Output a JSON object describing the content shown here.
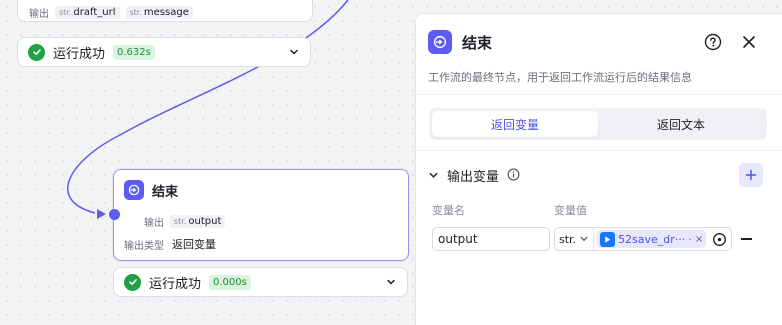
{
  "canvas": {
    "top_node": {
      "output_label": "输出",
      "outputs": [
        {
          "type": "str.",
          "name": "draft_url"
        },
        {
          "type": "str.",
          "name": "message"
        }
      ]
    },
    "status_top": {
      "label": "运行成功",
      "time": "0.632s"
    },
    "end_node": {
      "title": "结束",
      "output_label": "输出",
      "output_type": "str.",
      "output_name": "output",
      "output_kind_label": "输出类型",
      "output_kind_value": "返回变量"
    },
    "status_bottom": {
      "label": "运行成功",
      "time": "0.000s"
    }
  },
  "panel": {
    "title": "结束",
    "description": "工作流的最终节点，用于返回工作流运行后的结果信息",
    "tabs": [
      {
        "label": "返回变量",
        "active": true
      },
      {
        "label": "返回文本",
        "active": false
      }
    ],
    "section_title": "输出变量",
    "col_name": "变量名",
    "col_value": "变量值",
    "variable": {
      "name": "output",
      "type": "str.",
      "ref_text": "52save_dr···",
      "ref_suffix": "·"
    }
  },
  "colors": {
    "accent": "#5c5cf0",
    "success": "#22a046",
    "success_badge_bg": "#d9f5df"
  }
}
